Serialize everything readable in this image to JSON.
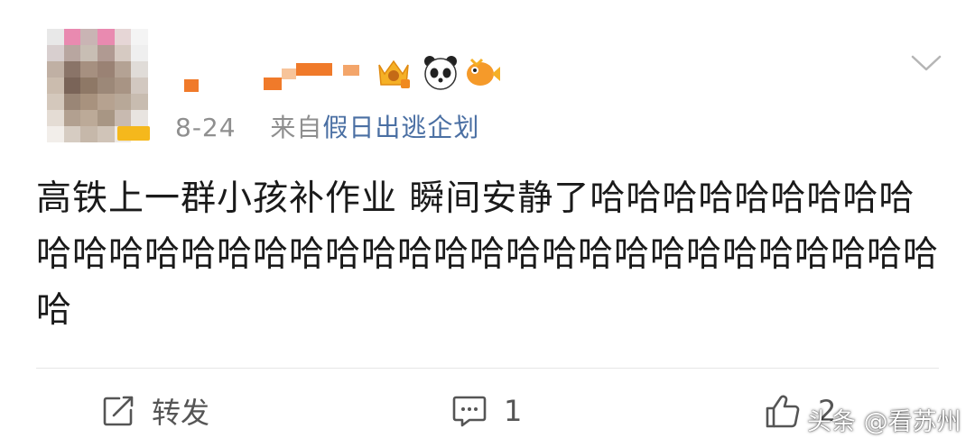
{
  "post": {
    "date": "8-24",
    "source_prefix": "来自",
    "source_name": "假日出逃企划",
    "content": "高铁上一群小孩补作业 瞬间安静了哈哈哈哈哈哈哈哈哈哈哈哈哈哈哈哈哈哈哈哈哈哈哈哈哈哈哈哈哈哈哈哈哈哈哈"
  },
  "actions": {
    "repost_label": "转发",
    "comment_count": "1",
    "like_count": "2"
  },
  "badges": [
    "crown-level-badge-icon",
    "panda-icon",
    "fish-icon"
  ],
  "watermark": "头条 @看苏州",
  "colors": {
    "text": "#1a1a1a",
    "meta": "#8f8f8f",
    "source_link": "#4a6fa3",
    "icon": "#555555",
    "badge_gold": "#f5b81c"
  }
}
